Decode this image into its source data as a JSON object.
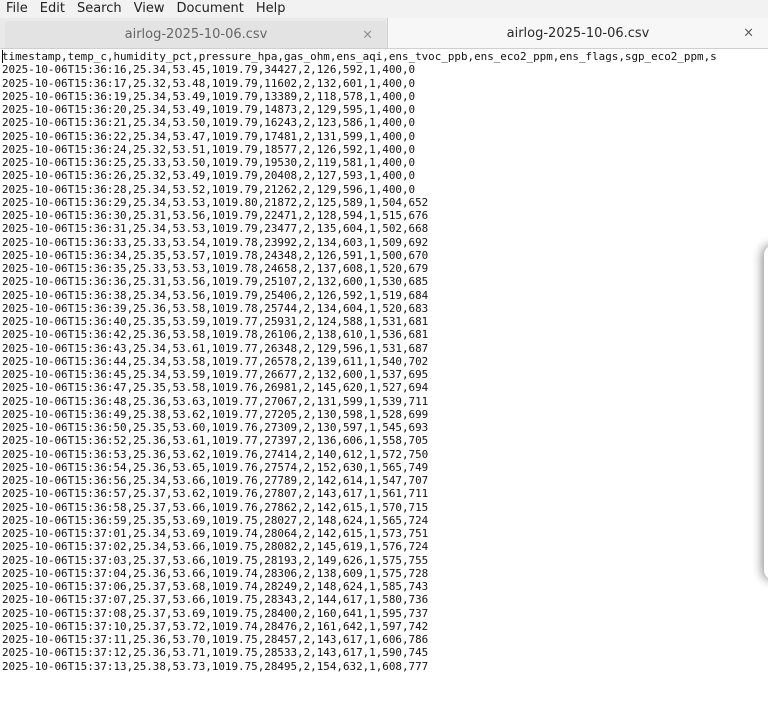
{
  "menubar": {
    "items": [
      "File",
      "Edit",
      "Search",
      "View",
      "Document",
      "Help"
    ]
  },
  "tabs": [
    {
      "label": "airlog-2025-10-06.csv",
      "close": "×",
      "active": false
    },
    {
      "label": "airlog-2025-10-06.csv",
      "close": "×",
      "active": true
    }
  ],
  "editor": {
    "lines": [
      "timestamp,temp_c,humidity_pct,pressure_hpa,gas_ohm,ens_aqi,ens_tvoc_ppb,ens_eco2_ppm,ens_flags,sgp_eco2_ppm,s",
      "2025-10-06T15:36:16,25.34,53.45,1019.79,34427,2,126,592,1,400,0",
      "2025-10-06T15:36:17,25.32,53.48,1019.79,11602,2,132,601,1,400,0",
      "2025-10-06T15:36:19,25.34,53.49,1019.79,13389,2,118,578,1,400,0",
      "2025-10-06T15:36:20,25.34,53.49,1019.79,14873,2,129,595,1,400,0",
      "2025-10-06T15:36:21,25.34,53.50,1019.79,16243,2,123,586,1,400,0",
      "2025-10-06T15:36:22,25.34,53.47,1019.79,17481,2,131,599,1,400,0",
      "2025-10-06T15:36:24,25.32,53.51,1019.79,18577,2,126,592,1,400,0",
      "2025-10-06T15:36:25,25.33,53.50,1019.79,19530,2,119,581,1,400,0",
      "2025-10-06T15:36:26,25.32,53.49,1019.79,20408,2,127,593,1,400,0",
      "2025-10-06T15:36:28,25.34,53.52,1019.79,21262,2,129,596,1,400,0",
      "2025-10-06T15:36:29,25.34,53.53,1019.80,21872,2,125,589,1,504,652",
      "2025-10-06T15:36:30,25.31,53.56,1019.79,22471,2,128,594,1,515,676",
      "2025-10-06T15:36:31,25.34,53.53,1019.79,23477,2,135,604,1,502,668",
      "2025-10-06T15:36:33,25.33,53.54,1019.78,23992,2,134,603,1,509,692",
      "2025-10-06T15:36:34,25.35,53.57,1019.78,24348,2,126,591,1,500,670",
      "2025-10-06T15:36:35,25.33,53.53,1019.78,24658,2,137,608,1,520,679",
      "2025-10-06T15:36:36,25.31,53.56,1019.79,25107,2,132,600,1,530,685",
      "2025-10-06T15:36:38,25.34,53.56,1019.79,25406,2,126,592,1,519,684",
      "2025-10-06T15:36:39,25.36,53.58,1019.78,25744,2,134,604,1,520,683",
      "2025-10-06T15:36:40,25.35,53.59,1019.77,25931,2,124,588,1,531,681",
      "2025-10-06T15:36:42,25.36,53.58,1019.78,26106,2,138,610,1,536,681",
      "2025-10-06T15:36:43,25.34,53.61,1019.77,26348,2,129,596,1,531,687",
      "2025-10-06T15:36:44,25.34,53.58,1019.77,26578,2,139,611,1,540,702",
      "2025-10-06T15:36:45,25.34,53.59,1019.77,26677,2,132,600,1,537,695",
      "2025-10-06T15:36:47,25.35,53.58,1019.76,26981,2,145,620,1,527,694",
      "2025-10-06T15:36:48,25.36,53.63,1019.77,27067,2,131,599,1,539,711",
      "2025-10-06T15:36:49,25.38,53.62,1019.77,27205,2,130,598,1,528,699",
      "2025-10-06T15:36:50,25.35,53.60,1019.76,27309,2,130,597,1,545,693",
      "2025-10-06T15:36:52,25.36,53.61,1019.77,27397,2,136,606,1,558,705",
      "2025-10-06T15:36:53,25.36,53.62,1019.76,27414,2,140,612,1,572,750",
      "2025-10-06T15:36:54,25.36,53.65,1019.76,27574,2,152,630,1,565,749",
      "2025-10-06T15:36:56,25.34,53.66,1019.76,27789,2,142,614,1,547,707",
      "2025-10-06T15:36:57,25.37,53.62,1019.76,27807,2,143,617,1,561,711",
      "2025-10-06T15:36:58,25.37,53.66,1019.76,27862,2,142,615,1,570,715",
      "2025-10-06T15:36:59,25.35,53.69,1019.75,28027,2,148,624,1,565,724",
      "2025-10-06T15:37:01,25.34,53.69,1019.74,28064,2,142,615,1,573,751",
      "2025-10-06T15:37:02,25.34,53.66,1019.75,28082,2,145,619,1,576,724",
      "2025-10-06T15:37:03,25.37,53.66,1019.75,28193,2,149,626,1,575,755",
      "2025-10-06T15:37:04,25.36,53.66,1019.74,28306,2,138,609,1,575,728",
      "2025-10-06T15:37:06,25.37,53.68,1019.74,28249,2,148,624,1,585,743",
      "2025-10-06T15:37:07,25.37,53.66,1019.75,28343,2,144,617,1,580,736",
      "2025-10-06T15:37:08,25.37,53.69,1019.75,28400,2,160,641,1,595,737",
      "2025-10-06T15:37:10,25.37,53.72,1019.74,28476,2,161,642,1,597,742",
      "2025-10-06T15:37:11,25.36,53.70,1019.75,28457,2,143,617,1,606,786",
      "2025-10-06T15:37:12,25.36,53.71,1019.75,28533,2,143,617,1,590,745",
      "2025-10-06T15:37:13,25.38,53.73,1019.75,28495,2,154,632,1,608,777"
    ]
  }
}
